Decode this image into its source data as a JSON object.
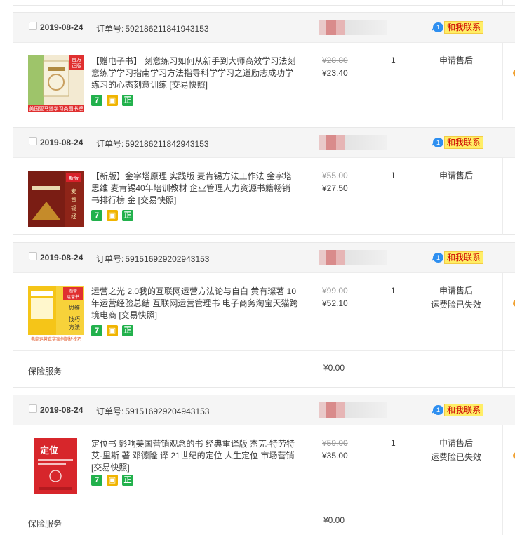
{
  "labels": {
    "order_no_prefix": "订单号:",
    "contact": "和我联系",
    "contact_badge": "1"
  },
  "orders": [
    {
      "date": "2019-08-24",
      "order_no": "592186211841943153",
      "title": "【赠电子书】 刻意练习如何从新手到大师高效学习法刻意练学学习指南学习方法指导科学学习之道励志成功学练习的心态刻意训练 [交易快照]",
      "badges": [
        "7",
        "盾",
        "正"
      ],
      "original_price": "¥28.80",
      "price": "¥23.40",
      "qty": "1",
      "status": [
        "申请售后"
      ],
      "cover_color": "#f1e6c8",
      "cover_tag": "官方正版",
      "cover_bottom": "美国亚马逊学习类图书榜"
    },
    {
      "date": "2019-08-24",
      "order_no": "592186211842943153",
      "title": "【新版】金字塔原理 实践版 麦肯锡方法工作法 金字塔思维 麦肯锡40年培训教材 企业管理人力资源书籍畅销书排行榜 金 [交易快照]",
      "badges": [
        "7",
        "盾",
        "正"
      ],
      "original_price": "¥55.00",
      "price": "¥27.50",
      "qty": "1",
      "status": [
        "申请售后"
      ],
      "cover_color": "#7a1d14",
      "cover_tag": "新版",
      "cover_bottom": "麦肯锡经典理论"
    },
    {
      "date": "2019-08-24",
      "order_no": "591516929202943153",
      "title": "运营之光 2.0我的互联网运营方法论与自白 黄有璨著 10年运营经验总结 互联网运营管理书 电子商务淘宝天猫跨境电商 [交易快照]",
      "badges": [
        "7",
        "盾",
        "正"
      ],
      "original_price": "¥99.00",
      "price": "¥52.10",
      "qty": "1",
      "status": [
        "申请售后",
        "运费险已失效"
      ],
      "cover_color": "#f5c518",
      "cover_tag": "思维",
      "cover_bottom": "电商运营真实案例剖析技巧",
      "insurance": {
        "label": "保险服务",
        "price": "¥0.00"
      }
    },
    {
      "date": "2019-08-24",
      "order_no": "591516929204943153",
      "title": "定位书 影响美国营销观念的书 经典重译版 杰克·特劳特 艾·里斯 著 邓德隆 译 21世纪的定位 人生定位 市场营销 [交易快照]",
      "badges": [
        "7",
        "盾",
        "正"
      ],
      "original_price": "¥59.00",
      "price": "¥35.00",
      "qty": "1",
      "status": [
        "申请售后",
        "运费险已失效"
      ],
      "cover_color": "#d7262b",
      "cover_tag": "定位",
      "cover_bottom": "",
      "insurance": {
        "label": "保险服务",
        "price": "¥0.00"
      }
    }
  ]
}
